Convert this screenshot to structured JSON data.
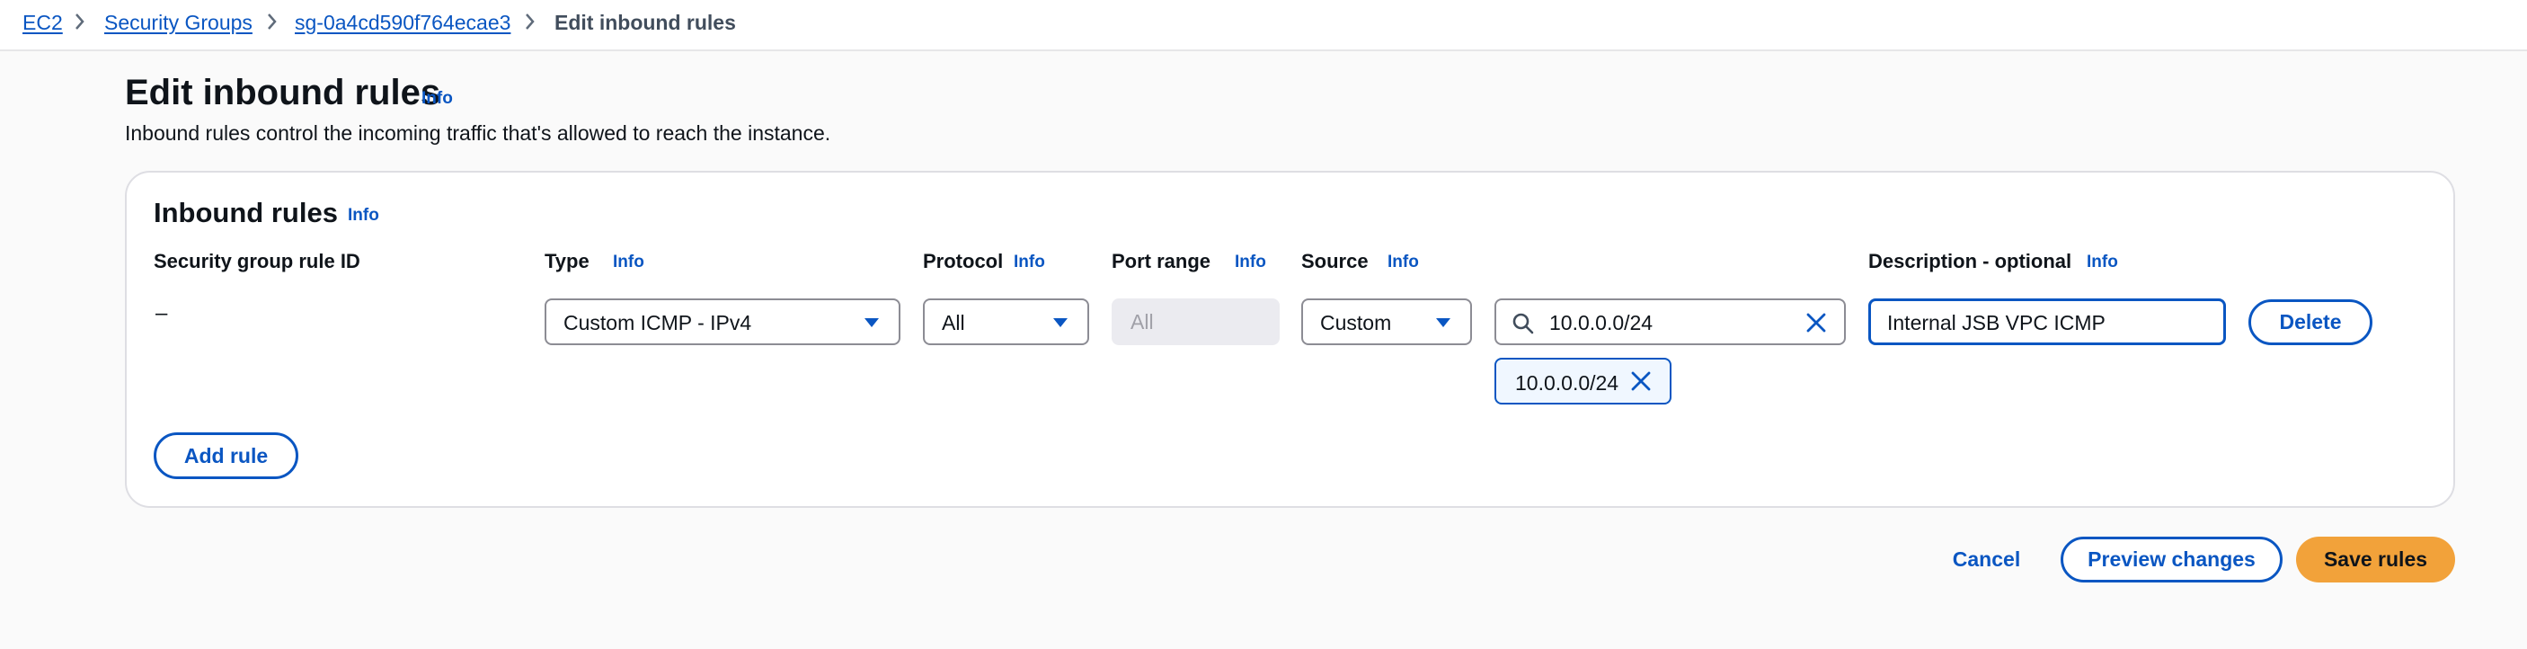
{
  "breadcrumb": {
    "items": [
      "EC2",
      "Security Groups",
      "sg-0a4cd590f764ecae3"
    ],
    "current": "Edit inbound rules"
  },
  "page": {
    "title": "Edit inbound rules",
    "info": "Info",
    "description": "Inbound rules control the incoming traffic that's allowed to reach the instance."
  },
  "inbound_rules": {
    "title": "Inbound rules",
    "info": "Info",
    "columns": {
      "rule_id": "Security group rule ID",
      "type": "Type",
      "protocol": "Protocol",
      "port_range": "Port range",
      "source": "Source",
      "description": "Description - optional",
      "info": "Info"
    },
    "rows": [
      {
        "rule_id": "–",
        "type": "Custom ICMP - IPv4",
        "protocol": "All",
        "port_range_placeholder": "All",
        "source": "Custom",
        "source_search": "10.0.0.0/24",
        "source_token": "10.0.0.0/24",
        "description": "Internal JSB VPC ICMP",
        "delete_label": "Delete"
      }
    ],
    "add_rule_label": "Add rule"
  },
  "footer": {
    "cancel_label": "Cancel",
    "preview_label": "Preview changes",
    "save_label": "Save rules"
  },
  "colors": {
    "link": "#0a56c2",
    "primary_button": "#f2a23a",
    "border": "#8c8c94"
  }
}
